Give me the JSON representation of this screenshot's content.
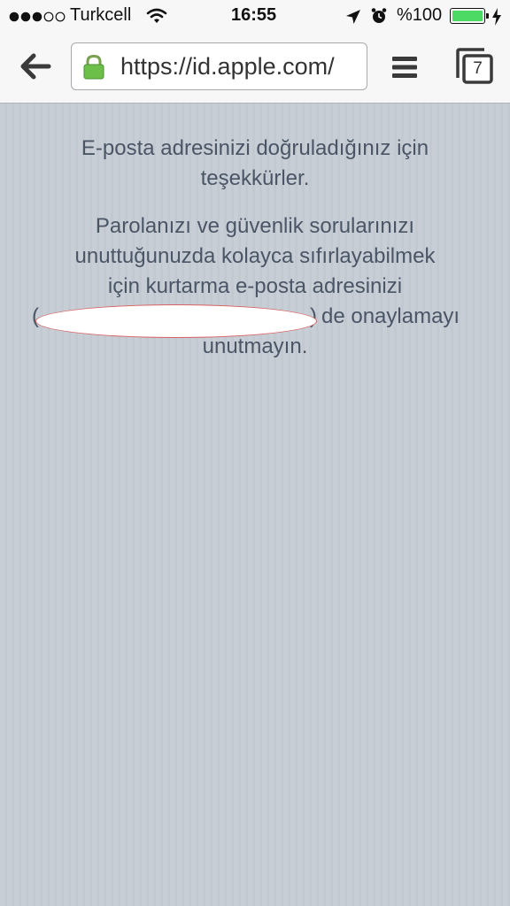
{
  "status_bar": {
    "carrier": "Turkcell",
    "time": "16:55",
    "battery": "%100",
    "signal_bars": 3,
    "signal_total": 5,
    "battery_level": 1.0
  },
  "browser": {
    "url": "https://id.apple.com/",
    "tab_count": "7"
  },
  "page": {
    "para1_line1": "E-posta adresinizi doğruladığınız için",
    "para1_line2": "teşekkürler.",
    "para2_line1": "Parolanızı ve güvenlik sorularınızı",
    "para2_line2": "unuttuğunuzda kolayca sıfırlayabilmek",
    "para2_line3": "için kurtarma e-posta adresinizi",
    "para2_open_paren": "(",
    "para2_close_paren": ")",
    "para2_line4_tail": "de onaylamayı",
    "para2_line5": "unutmayın."
  },
  "colors": {
    "page_background": "#c8ced6",
    "text": "#4a5566",
    "battery_green": "#4cd964",
    "lock_green": "#6cc04a"
  }
}
